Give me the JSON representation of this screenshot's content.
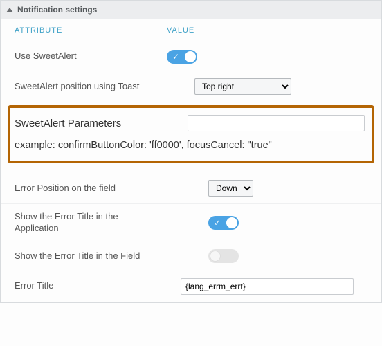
{
  "panel": {
    "title": "Notification settings"
  },
  "columns": {
    "attr": "ATTRIBUTE",
    "val": "VALUE"
  },
  "rows": {
    "use_sweetalert": {
      "label": "Use SweetAlert",
      "on": true
    },
    "position_toast": {
      "label": "SweetAlert position using Toast",
      "options": [
        "Top right"
      ],
      "selected": "Top right"
    },
    "params": {
      "label": "SweetAlert Parameters",
      "value": "",
      "example": "example: confirmButtonColor: 'ff0000', focusCancel: \"true\""
    },
    "error_pos": {
      "label": "Error Position on the field",
      "options": [
        "Down"
      ],
      "selected": "Down"
    },
    "show_title_app": {
      "label": "Show the Error Title in the Application",
      "on": true
    },
    "show_title_field": {
      "label": "Show the Error Title in the Field",
      "on": false
    },
    "error_title": {
      "label": "Error Title",
      "value": "{lang_errm_errt}"
    }
  }
}
